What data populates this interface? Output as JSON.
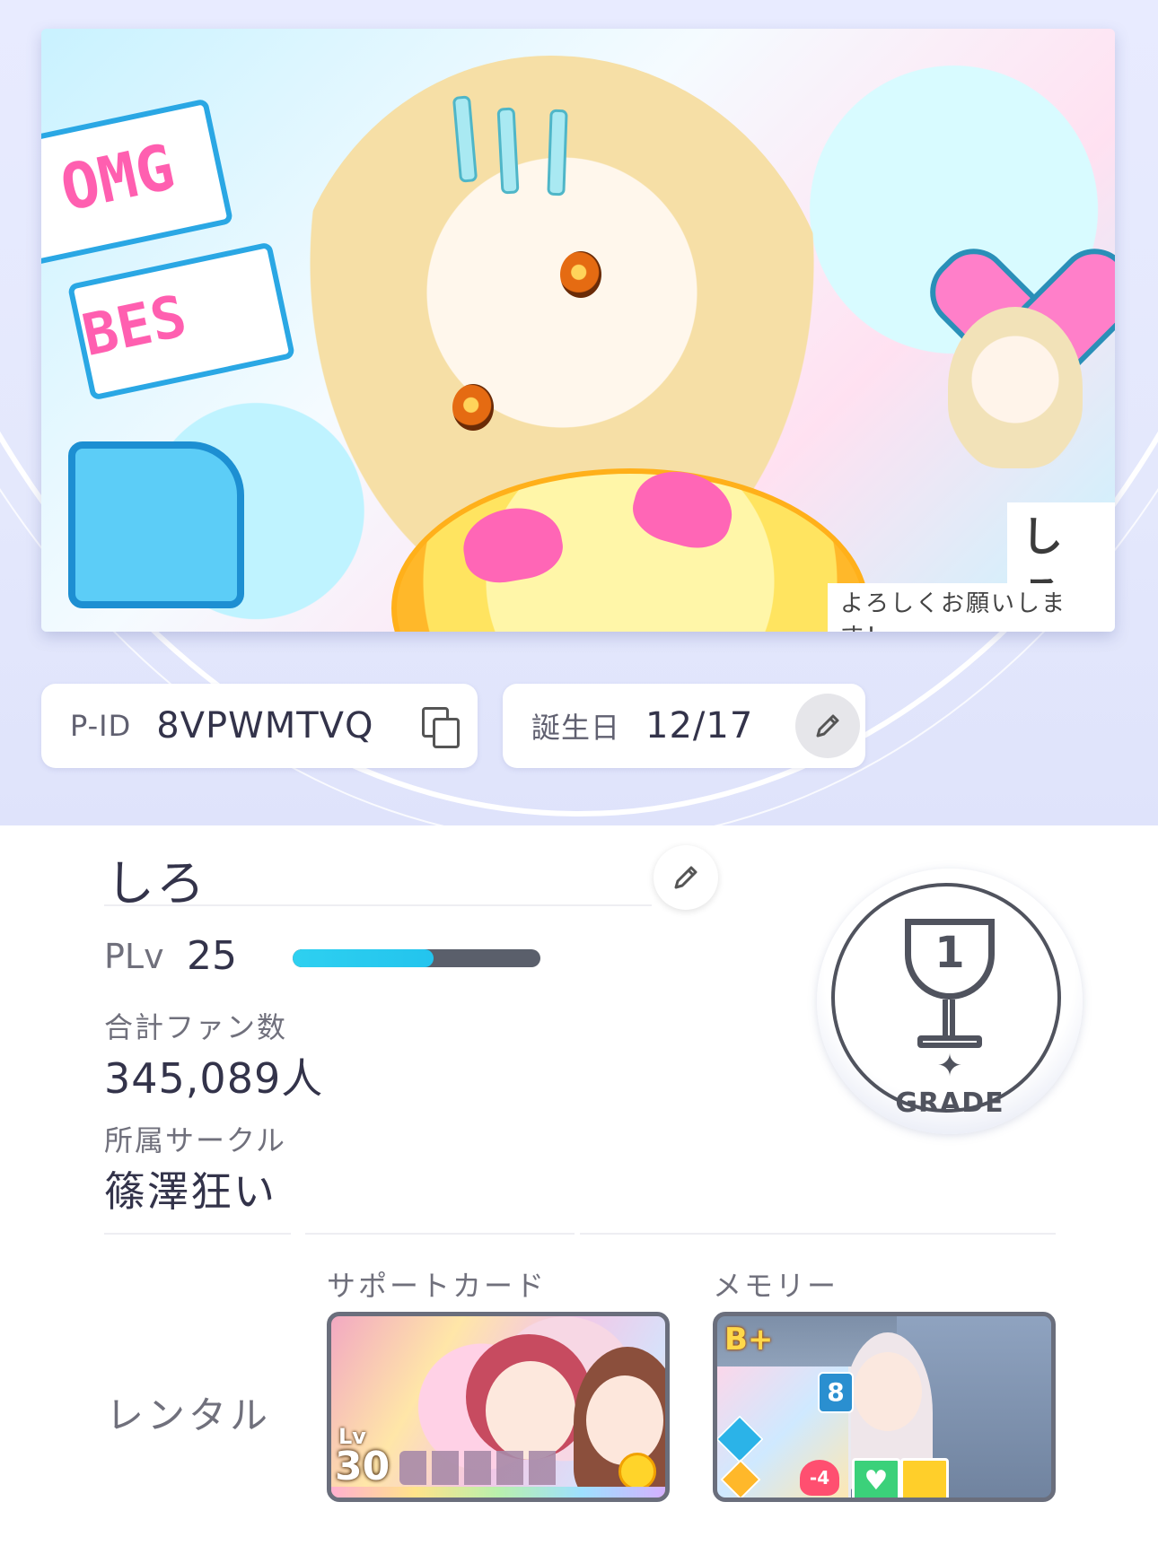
{
  "banner": {
    "name_tag": "しろ",
    "message": "よろしくお願いします！",
    "sign_1": "OMG",
    "sign_2": "BES"
  },
  "profile_ids": {
    "pid_label": "P-ID",
    "pid_value": "8VPWMTVQ",
    "birthday_label": "誕生日",
    "birthday_value": "12/17"
  },
  "player": {
    "name": "しろ",
    "plv_label": "PLv",
    "plv_value": "25",
    "plv_progress": 0.57,
    "fans_label": "合計ファン数",
    "fans_value": "345,089人",
    "circle_label": "所属サークル",
    "circle_value": "篠澤狂い"
  },
  "grade": {
    "rank": "1",
    "label": "GRADE"
  },
  "rental": {
    "label": "レンタル",
    "support_header": "サポートカード",
    "memory_header": "メモリー",
    "support_card": {
      "lv_label": "Lv",
      "lv_value": "30"
    },
    "memory_card": {
      "rank": "B+",
      "cost": "8",
      "modifier": "-4"
    }
  },
  "colors": {
    "accent_cyan": "#23c4ee",
    "text_dark": "#33334a",
    "text_muted": "#70707c"
  },
  "icons": [
    "copy-icon",
    "pencil-icon",
    "trophy-icon",
    "sparkle-icon"
  ]
}
